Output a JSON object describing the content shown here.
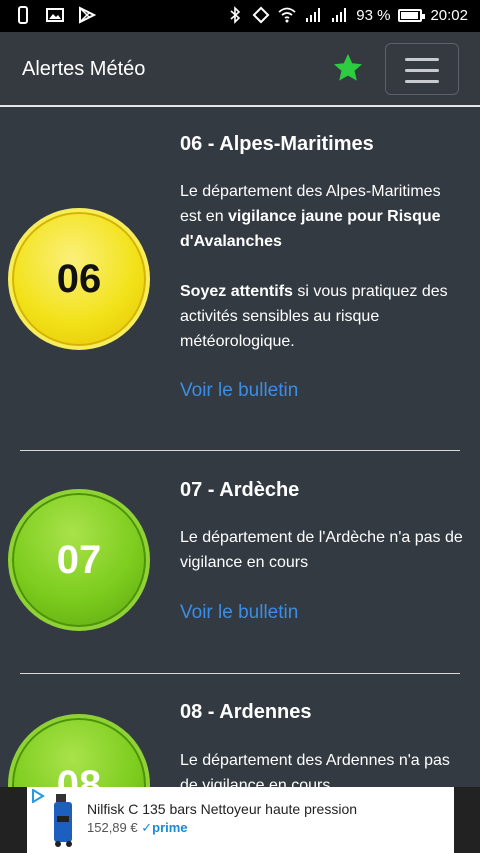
{
  "statusbar": {
    "battery": "93 %",
    "time": "20:02"
  },
  "navbar": {
    "title": "Alertes Météo"
  },
  "cards": [
    {
      "number": "06",
      "title": "06 - Alpes-Maritimes",
      "text_pre": "Le département des Alpes-Maritimes est en ",
      "text_bold": "vigilance jaune pour Risque d'Avalanches",
      "advice_bold": "Soyez attentifs",
      "advice_text": " si vous pratiquez des activités sensibles au risque météorologique.",
      "link": "Voir le bulletin",
      "color": "#f2e21a"
    },
    {
      "number": "07",
      "title": "07 - Ardèche",
      "text": "Le département de l'Ardèche n'a pas de vigilance en cours",
      "link": "Voir le bulletin",
      "color": "#7ccc1e"
    },
    {
      "number": "08",
      "title": "08 - Ardennes",
      "text": "Le département des Ardennes n'a pas de vigilance en cours",
      "color": "#7ccc1e"
    }
  ],
  "ad": {
    "title": "Nilfisk C 135 bars Nettoyeur haute pression",
    "price": "152,89 €",
    "prime": "✓prime"
  },
  "colors": {
    "link": "#3a8ee6",
    "background": "#333a42",
    "star": "#2ecc40"
  }
}
